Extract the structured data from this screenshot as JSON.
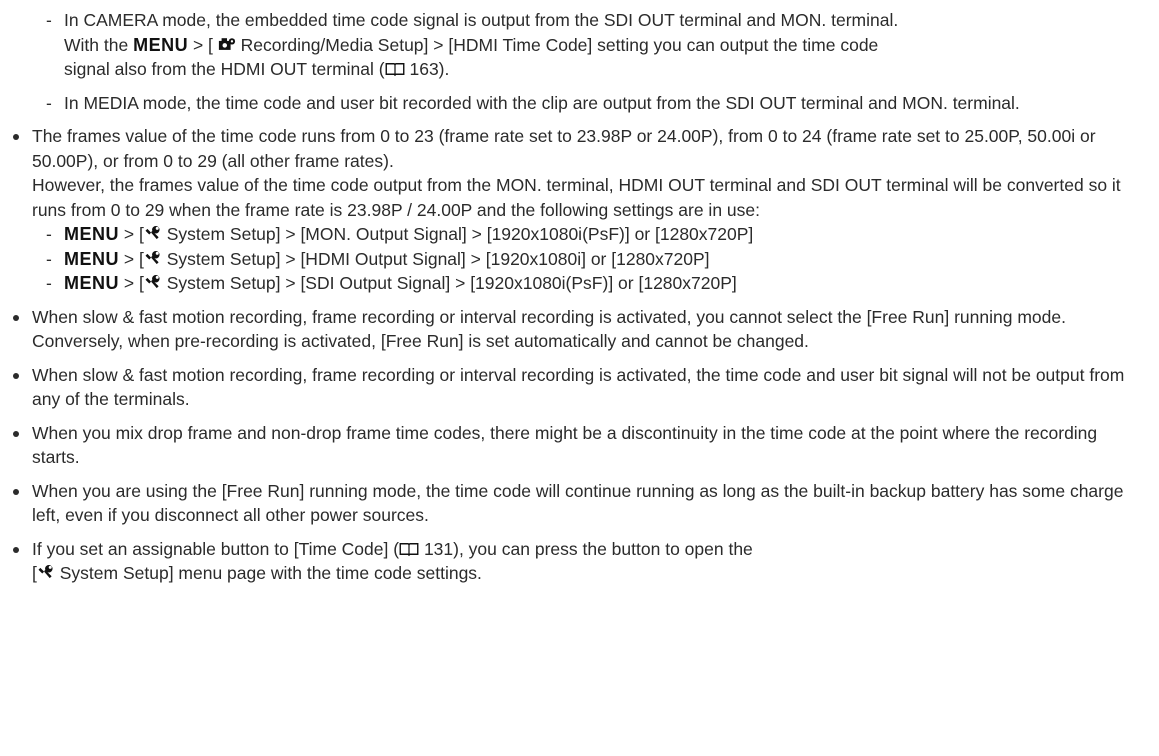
{
  "icons": {
    "menu": "MENU",
    "wrench": "wrench-icon",
    "camera_gear": "camera-gear-icon",
    "book": "book-icon"
  },
  "sub1": {
    "dash": "-",
    "line1_pre": "In CAMERA mode, the embedded time code signal is output from the SDI OUT terminal and MON. terminal.",
    "line2_pre": "With the",
    "line2_post": "> [",
    "line2_post2": "Recording/Media Setup] > [HDMI Time Code] setting you can output the time code",
    "line3": "signal also from the HDMI OUT terminal (",
    "line3_page": "163)."
  },
  "sub2": {
    "dash": "-",
    "text": "In MEDIA mode, the time code and user bit recorded with the clip are output from the SDI OUT terminal and MON. terminal."
  },
  "bullet1": {
    "text": "The frames value of the time code runs from 0 to 23 (frame rate set to 23.98P or 24.00P), from 0 to 24 (frame rate set to 25.00P, 50.00i or 50.00P), or from 0 to 29 (all other frame rates).",
    "cont": "However, the frames value of the time code output from the MON. terminal, HDMI OUT terminal and SDI OUT terminal will be converted so it runs from 0 to 29 when the frame rate is 23.98P / 24.00P and the following settings are in use:",
    "items": [
      {
        "dash": "-",
        "pre": "> [",
        "text": "System Setup] > [MON. Output Signal] > [1920x1080i(PsF)] or [1280x720P]"
      },
      {
        "dash": "-",
        "pre": "> [",
        "text": "System Setup] > [HDMI Output Signal] > [1920x1080i] or [1280x720P]"
      },
      {
        "dash": "-",
        "pre": "> [",
        "text": "System Setup] > [SDI Output Signal] > [1920x1080i(PsF)] or [1280x720P]"
      }
    ]
  },
  "bullet2": {
    "text": "When slow & fast motion recording, frame recording or interval recording is activated, you cannot select the [Free Run] running mode. Conversely, when pre-recording is activated, [Free Run] is set automatically and cannot be changed."
  },
  "bullet3": {
    "text": "When slow & fast motion recording, frame recording or interval recording is activated, the time code and user bit signal will not be output from any of the terminals."
  },
  "bullet4": {
    "text": "When you mix drop frame and non-drop frame time codes, there might be a discontinuity in the time code at the point where the recording starts."
  },
  "bullet5": {
    "text": "When you are using the [Free Run] running mode, the time code will continue running as long as the built-in backup battery has some charge left, even if you disconnect all other power sources."
  },
  "bullet6": {
    "line1": "If you set an assignable button to [Time Code] (",
    "line1_page": "131), you can press the button to open the",
    "line2_pre": "[",
    "line2": "System Setup] menu page with the time code settings."
  }
}
